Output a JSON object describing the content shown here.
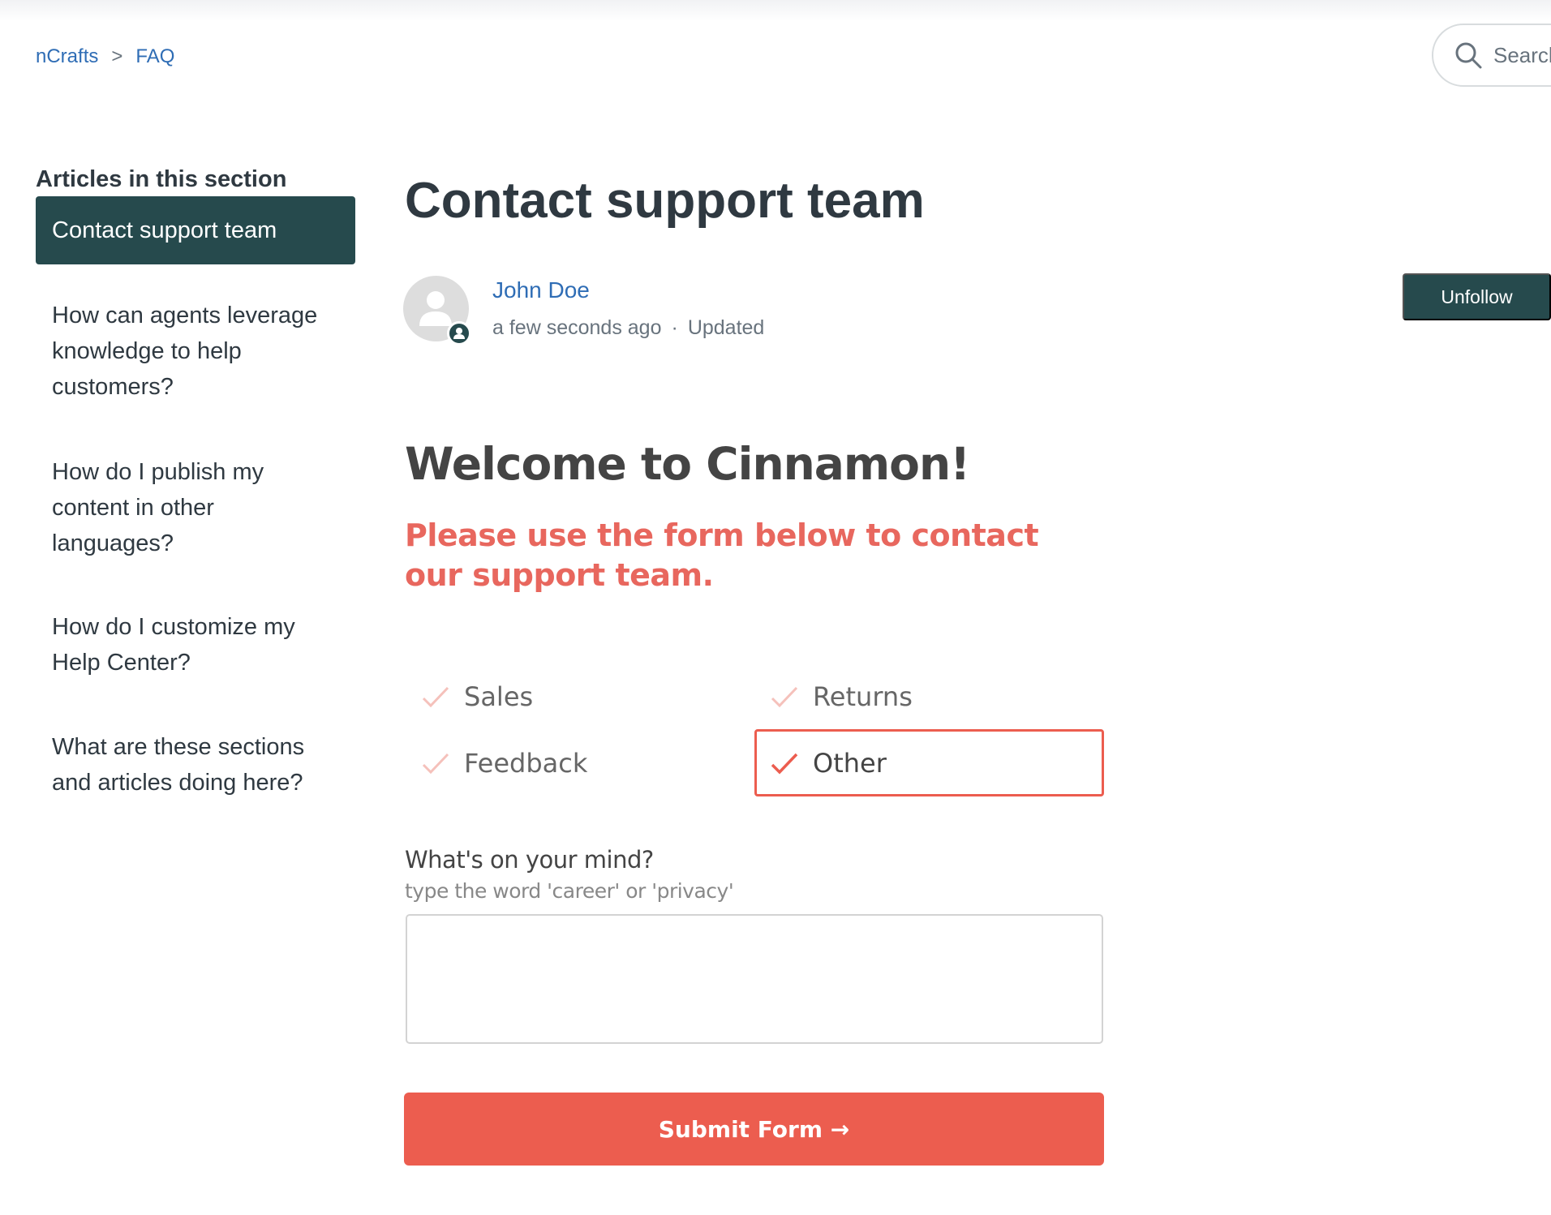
{
  "breadcrumb": {
    "items": [
      "nCrafts",
      "FAQ"
    ],
    "separator": ">"
  },
  "search": {
    "placeholder": "Search",
    "icon": "search-icon"
  },
  "sidebar": {
    "heading": "Articles in this section",
    "items": [
      {
        "label": "Contact support team",
        "active": true
      },
      {
        "label": "How can agents leverage knowledge to help customers?"
      },
      {
        "label": "How do I publish my content in other languages?"
      },
      {
        "label": "How do I customize my Help Center?"
      },
      {
        "label": "What are these sections and articles doing here?"
      }
    ]
  },
  "article": {
    "title": "Contact support team",
    "author": "John Doe",
    "time": "a few seconds ago",
    "dot": "·",
    "status": "Updated",
    "follow_label": "Unfollow"
  },
  "form": {
    "welcome": "Welcome to Cinnamon!",
    "intro": "Please use the form below to contact our support team.",
    "options": [
      {
        "label": "Sales",
        "selected": false
      },
      {
        "label": "Returns",
        "selected": false
      },
      {
        "label": "Feedback",
        "selected": false
      },
      {
        "label": "Other",
        "selected": true
      }
    ],
    "question_label": "What's on your mind?",
    "question_hint": "type the word 'career' or 'privacy'",
    "textarea_value": "",
    "submit_label": "Submit Form →"
  },
  "colors": {
    "primary": "#264a4d",
    "link": "#2f6db5",
    "accent": "#ec5d4f"
  }
}
